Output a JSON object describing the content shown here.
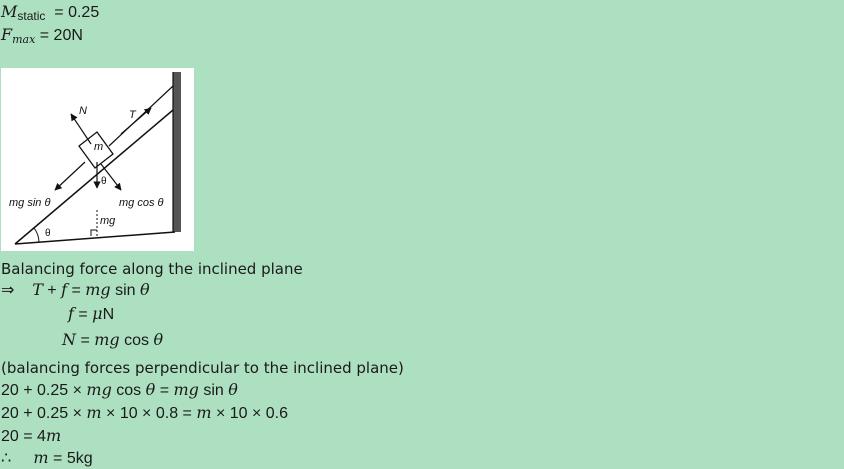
{
  "given": {
    "mu_symbol": "M",
    "mu_subscript": "static",
    "mu_value": "= 0.25",
    "fmax_symbol": "F",
    "fmax_subscript": "max",
    "fmax_value": "= 20N"
  },
  "figure": {
    "label_N": "N",
    "label_T": "T",
    "label_m": "m",
    "label_theta_block": "θ",
    "label_mg_sin": "mg sin θ",
    "label_mg_cos": "mg cos θ",
    "label_mg": "mg",
    "label_theta_angle": "θ"
  },
  "text": {
    "balance_heading": "Balancing force along the inclined plane",
    "implies": "⇒",
    "eq1_T": "T",
    "eq1_plus": " + ",
    "eq1_f": "f",
    "eq1_eq": " = ",
    "eq1_mg": "mg",
    "eq1_fn": " sin ",
    "eq1_theta": "θ",
    "eq2_f": "f",
    "eq2_eq": " = ",
    "eq2_mu": "μ",
    "eq2_N": "N",
    "eq3_N": "N",
    "eq3_eq": " = ",
    "eq3_mg": "mg",
    "eq3_fn": " cos ",
    "eq3_theta": "θ",
    "perp_note": "(balancing forces perpendicular to the inclined plane)",
    "eq4_a": "20 + 0.25 × ",
    "eq4_mg": "mg",
    "eq4_cos": " cos ",
    "eq4_theta1": "θ",
    "eq4_eq": " = ",
    "eq4_mg2": "mg",
    "eq4_sin": " sin ",
    "eq4_theta2": "θ",
    "eq5_a": "20 + 0.25 × ",
    "eq5_m1": "m",
    "eq5_b": " × 10 × 0.8 = ",
    "eq5_m2": "m",
    "eq5_c": " × 10 × 0.6",
    "eq6_a": "20 = 4",
    "eq6_m": "m",
    "therefore": "∴",
    "eq7_m": "m",
    "eq7_val": " = 5kg"
  }
}
